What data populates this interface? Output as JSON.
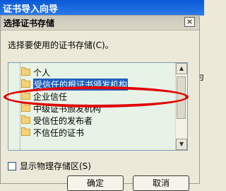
{
  "parent_window": {
    "title": "证书导入向导",
    "side_text": "为"
  },
  "dialog": {
    "title": "选择证书存储",
    "close_label": "×",
    "prompt": "选择要使用的证书存储(C)。"
  },
  "tree": {
    "items": [
      {
        "label": "个人",
        "selected": false
      },
      {
        "label": "受信任的根证书颁发机构",
        "selected": true
      },
      {
        "label": "企业信任",
        "selected": false
      },
      {
        "label": "中级证书颁发机构",
        "selected": false
      },
      {
        "label": "受信任的发布者",
        "selected": false
      },
      {
        "label": "不信任的证书",
        "selected": false
      }
    ]
  },
  "scrollbar": {
    "up_arrow": "▲",
    "down_arrow": "▼"
  },
  "checkbox": {
    "label": "显示物理存储区(S)",
    "checked": false
  },
  "buttons": {
    "ok": "确定",
    "cancel": "取消"
  },
  "colors": {
    "annotation": "#E10000",
    "selection": "#1D5FBF"
  }
}
